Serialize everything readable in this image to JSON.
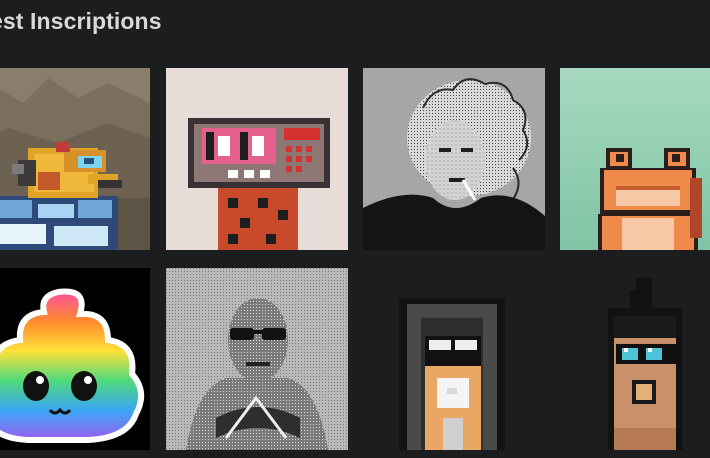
{
  "section": {
    "title": "est Inscriptions"
  },
  "inscriptions": [
    {
      "art": "pixel-dragon-in-cauldron"
    },
    {
      "art": "pixel-robot-pink-glasses"
    },
    {
      "art": "dithered-curly-hair-portrait"
    },
    {
      "art": "pixel-orange-frog"
    },
    {
      "art": "rainbow-poop-emoji"
    },
    {
      "art": "dithered-man-sunglasses"
    },
    {
      "art": "pixel-hooded-face"
    },
    {
      "art": "pixel-punk-mohawk"
    }
  ],
  "colors": {
    "background": "#1c1d1f",
    "title": "#d9d9d9"
  }
}
